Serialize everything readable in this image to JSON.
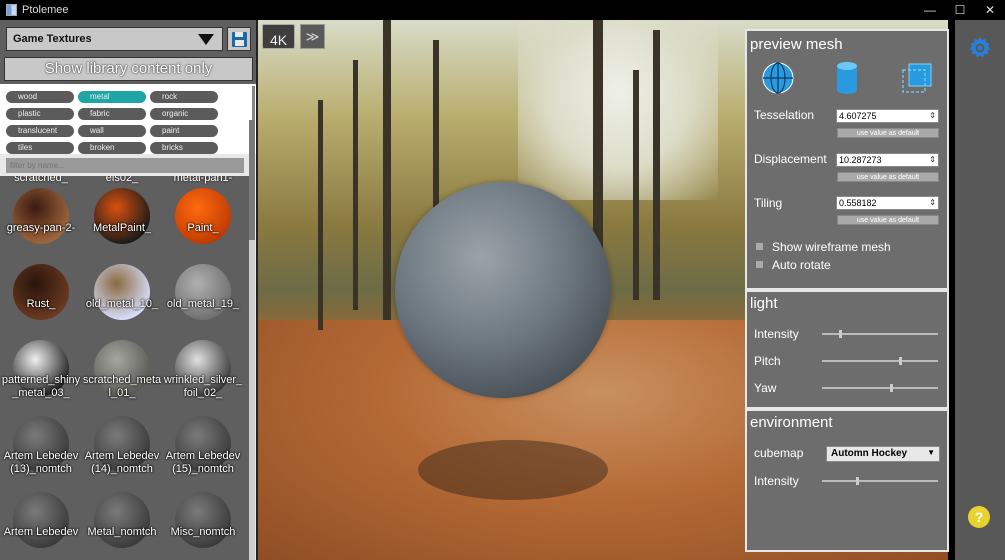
{
  "window": {
    "title": "Ptolemee",
    "minimize": "—",
    "maximize": "☐",
    "close": "✕"
  },
  "library": {
    "selected": "Game Textures",
    "show_library_button": "Show library content only",
    "filter_placeholder": "filter by name...",
    "tags": [
      {
        "label": "wood",
        "active": false
      },
      {
        "label": "metal",
        "active": true
      },
      {
        "label": "rock",
        "active": false
      },
      {
        "label": "plastic",
        "active": false
      },
      {
        "label": "fabric",
        "active": false
      },
      {
        "label": "organic",
        "active": false
      },
      {
        "label": "translucent",
        "active": false
      },
      {
        "label": "wall",
        "active": false
      },
      {
        "label": "paint",
        "active": false
      },
      {
        "label": "tiles",
        "active": false
      },
      {
        "label": "broken",
        "active": false
      },
      {
        "label": "bricks",
        "active": false
      }
    ],
    "cut_labels": [
      "scratched_",
      "els02_",
      "metal-pan1-"
    ],
    "materials": [
      {
        "label": "greasy-pan-2-",
        "color": "#3a1a10",
        "color2": "#a0673d"
      },
      {
        "label": "MetalPaint_",
        "color": "#d85010",
        "color2": "#1a1a1a"
      },
      {
        "label": "Paint_",
        "color": "#ff6a10",
        "color2": "#c03a00"
      },
      {
        "label": "Rust_",
        "color": "#2a140c",
        "color2": "#6b3a20"
      },
      {
        "label": "old_metal_10_",
        "color": "#8a6a40",
        "color2": "#d8e0ff"
      },
      {
        "label": "old_metal_19_",
        "color": "#b0b0b0",
        "color2": "#6f6f6f"
      },
      {
        "label": "patterned_shiny_metal_03_",
        "color": "#f0f0f0",
        "color2": "#202020"
      },
      {
        "label": "scratched_metal_01_",
        "color": "#a6a6a0",
        "color2": "#5a5a55"
      },
      {
        "label": "wrinkled_silver_foil_02_",
        "color": "#e0e0e0",
        "color2": "#3a3a3a"
      },
      {
        "label": "Artem Lebedev (13)_nomtch",
        "color": "#7a7a7a",
        "color2": "#3a3a3a"
      },
      {
        "label": "Artem Lebedev (14)_nomtch",
        "color": "#7a7a7a",
        "color2": "#3a3a3a"
      },
      {
        "label": "Artem Lebedev (15)_nomtch",
        "color": "#7a7a7a",
        "color2": "#3a3a3a"
      },
      {
        "label": "Artem Lebedev",
        "color": "#7a7a7a",
        "color2": "#3a3a3a"
      },
      {
        "label": "Metal_nomtch",
        "color": "#7a7a7a",
        "color2": "#3a3a3a"
      },
      {
        "label": "Misc_nomtch",
        "color": "#7a7a7a",
        "color2": "#3a3a3a"
      }
    ]
  },
  "viewport": {
    "quality_button": "4K",
    "next_button": "≫"
  },
  "preview_mesh": {
    "title": "preview mesh",
    "mesh_icons": [
      "globe-icon",
      "cylinder-icon",
      "plane-icon"
    ],
    "tesselation": {
      "label": "Tesselation",
      "value": "4.607275",
      "default_button": "use value as default"
    },
    "displacement": {
      "label": "Displacement",
      "value": "10.287273",
      "default_button": "use value as default"
    },
    "tiling": {
      "label": "Tiling",
      "value": "0.558182",
      "default_button": "use value as default"
    },
    "wireframe": "Show wireframe mesh",
    "auto_rotate": "Auto rotate"
  },
  "light": {
    "title": "light",
    "intensity": {
      "label": "Intensity",
      "level": 0.15
    },
    "pitch": {
      "label": "Pitch",
      "level": 0.68
    },
    "yaw": {
      "label": "Yaw",
      "level": 0.6
    }
  },
  "environment": {
    "title": "environment",
    "cubemap_label": "cubemap",
    "cubemap_value": "Automn Hockey",
    "intensity": {
      "label": "Intensity",
      "level": 0.3
    }
  },
  "colors": {
    "accent": "#1ea6a6",
    "gear": "#2a7fd4",
    "help": "#e8d230"
  }
}
